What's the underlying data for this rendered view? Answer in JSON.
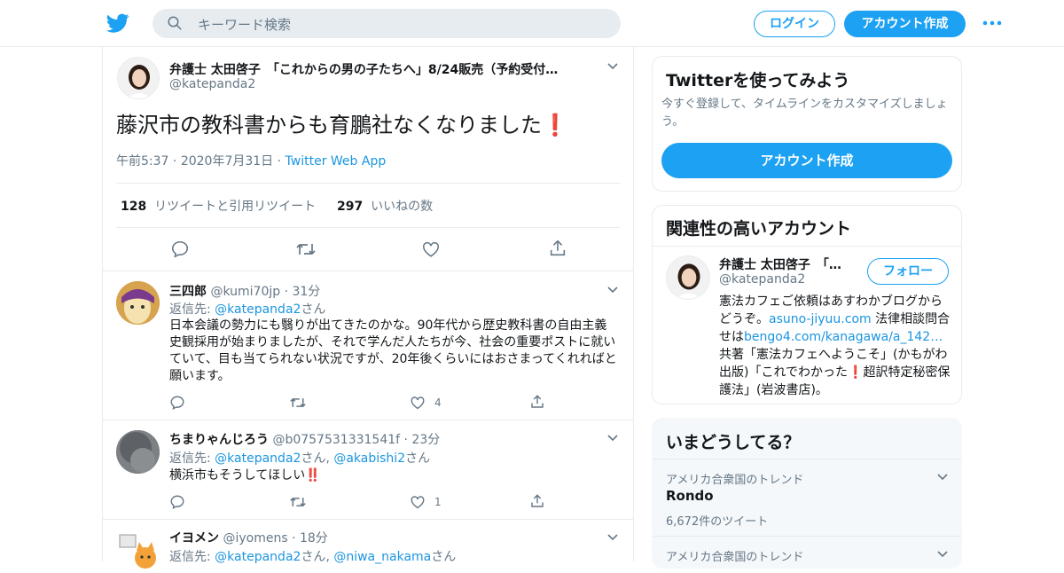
{
  "header": {
    "search_placeholder": "キーワード検索",
    "login_label": "ログイン",
    "signup_label": "アカウント作成"
  },
  "tweet": {
    "author_name": "弁護士 太田啓子　「これからの男の子たちへ」8/24販売（予約受付…",
    "handle": "@katepanda2",
    "text": "藤沢市の教科書からも育鵬社なくなりました❗",
    "time": "午前5:37",
    "date": "2020年7月31日",
    "source": "Twitter Web App",
    "retweet_count": "128",
    "retweet_label": "リツイートと引用リツイート",
    "like_count": "297",
    "like_label": "いいねの数"
  },
  "replies": [
    {
      "name": "三四郎",
      "handle": "@kumi70jp",
      "time": "31分",
      "reply_to_prefix": "返信先: ",
      "reply_to_links": [
        "@katepanda2"
      ],
      "reply_to_suffix": "さん",
      "text": "日本会議の勢力にも翳りが出てきたのかな。90年代から歴史教科書の自由主義史観採用が始まりましたが、それで学んだ人たちが今、社会の重要ポストに就いていて、目も当てられない状況ですが、20年後くらいにはおさまってくれればと願います。",
      "like_count": "4"
    },
    {
      "name": "ちまりゃんじろう",
      "handle": "@b0757531331541f",
      "time": "23分",
      "reply_to_prefix": "返信先: ",
      "reply_to_links": [
        "@katepanda2",
        "@akabishi2"
      ],
      "reply_to_suffix": "さん",
      "text": "横浜市もそうしてほしい‼️",
      "like_count": "1"
    },
    {
      "name": "イヨメン",
      "handle": "@iyomens",
      "time": "18分",
      "reply_to_prefix": "返信先: ",
      "reply_to_links": [
        "@katepanda2",
        "@niwa_nakama"
      ],
      "reply_to_suffix": "さん"
    }
  ],
  "sidebar": {
    "try_title": "Twitterを使ってみよう",
    "try_desc": "今すぐ登録して、タイムラインをカスタマイズしましょう。",
    "try_button": "アカウント作成",
    "related_title": "関連性の高いアカウント",
    "related": {
      "name": "弁護士 太田啓子　「…",
      "handle": "@katepanda2",
      "follow_label": "フォロー",
      "bio_1": "憲法カフェご依頼はあすわかブログからどうぞ。",
      "bio_link1": "asuno-jiyuu.com",
      "bio_2": " 法律相談問合せは",
      "bio_link2": "bengo4.com/kanagawa/a_142…",
      "bio_3": " 共著「憲法カフェへようこそ」(かもがわ出版)「これでわかった❗超訳特定秘密保護法」(岩波書店)。"
    },
    "trends_title": "いまどうしてる？",
    "trends": [
      {
        "context": "アメリカ合衆国のトレンド",
        "name": "Rondo",
        "count": "6,672件のツイート"
      },
      {
        "context": "アメリカ合衆国のトレンド"
      }
    ]
  },
  "colors": {
    "accent": "#1da1f2",
    "link": "#1b95e0",
    "muted": "#657786",
    "border": "#e6ecf0",
    "heart_red": "#e0245e"
  }
}
